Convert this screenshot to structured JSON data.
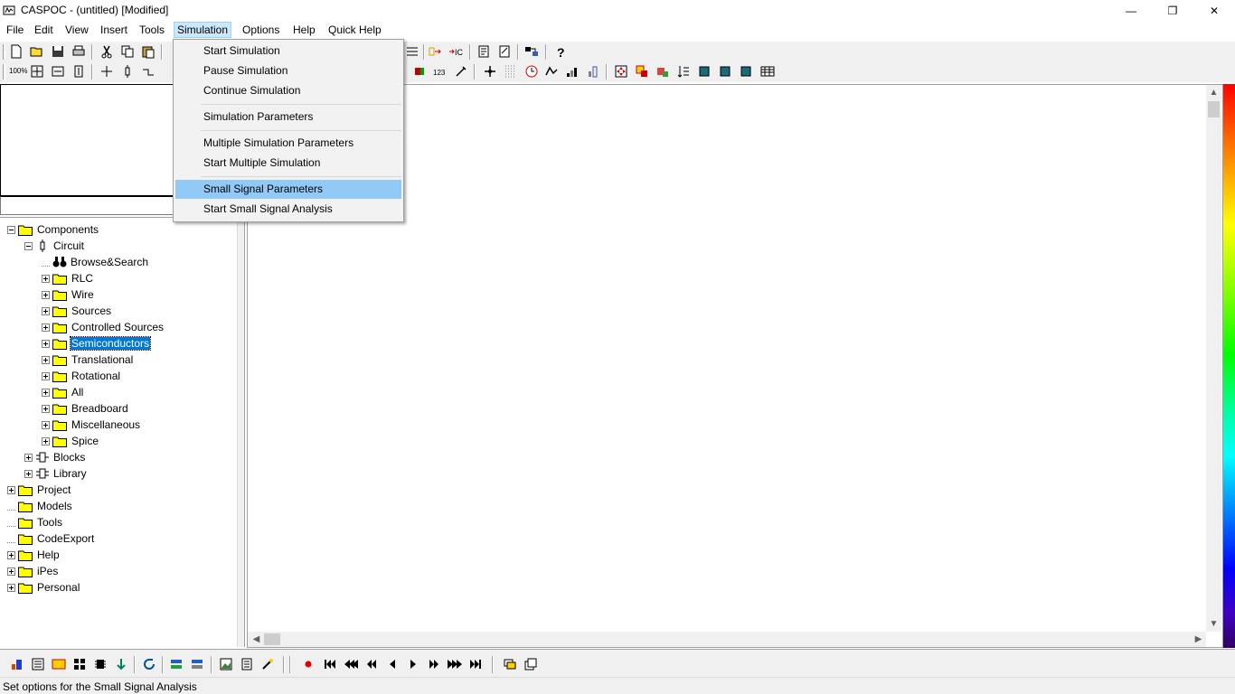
{
  "window": {
    "title": "CASPOC - (untitled) [Modified]",
    "controls": {
      "minimize": "—",
      "maximize": "❐",
      "close": "✕"
    }
  },
  "menubar": {
    "items": [
      "File",
      "Edit",
      "View",
      "Insert",
      "Tools",
      "Simulation",
      "Options",
      "Help",
      "Quick Help"
    ],
    "active": "Simulation"
  },
  "simulation_menu": {
    "groups": [
      [
        "Start Simulation",
        "Pause Simulation",
        "Continue Simulation"
      ],
      [
        "Simulation Parameters"
      ],
      [
        "Multiple Simulation Parameters",
        "Start Multiple Simulation"
      ],
      [
        "Small Signal Parameters",
        "Start Small Signal Analysis"
      ]
    ],
    "highlighted": "Small Signal Parameters"
  },
  "toolbar2": {
    "zoom_label": "100%",
    "counter_label": "123"
  },
  "tree": {
    "root": "Components",
    "circuit": "Circuit",
    "circuit_children": [
      "Browse&Search",
      "RLC",
      "Wire",
      "Sources",
      "Controlled Sources",
      "Semiconductors",
      "Translational",
      "Rotational",
      "All",
      "Breadboard",
      "Miscellaneous",
      "Spice"
    ],
    "selected": "Semiconductors",
    "component_siblings": [
      "Blocks",
      "Library"
    ],
    "top_level": [
      "Project",
      "Models",
      "Tools",
      "CodeExport",
      "Help",
      "iPes",
      "Personal"
    ]
  },
  "statusbar": {
    "text": "Set options for the Small Signal Analysis"
  },
  "colors": {
    "menu_highlight": "#91c9f7",
    "active_menu": "#cce8ff",
    "selection": "#0078d7",
    "folder": "#ffff00"
  }
}
